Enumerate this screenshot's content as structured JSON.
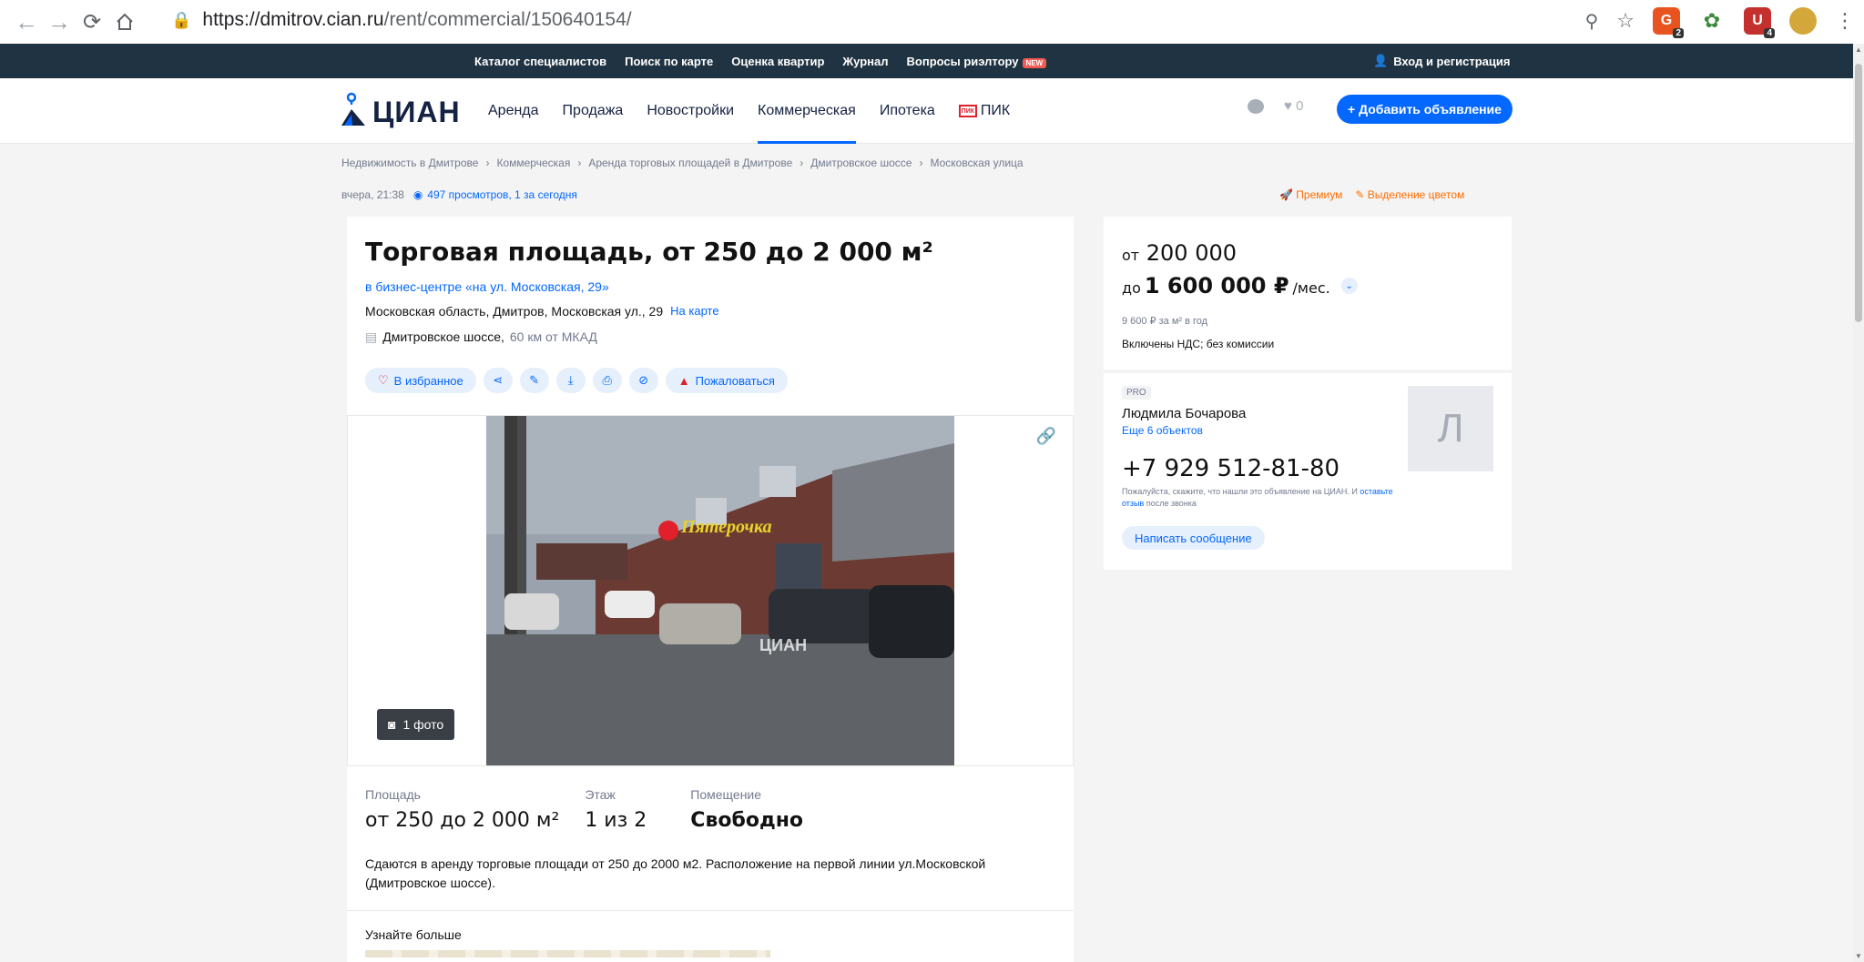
{
  "browser": {
    "url_host": "https://dmitrov.cian.ru",
    "url_path": "/rent/commercial/150640154/",
    "extension_badges": [
      "2",
      "4"
    ]
  },
  "topbar": {
    "links": [
      "Каталог специалистов",
      "Поиск по карте",
      "Оценка квартир",
      "Журнал",
      "Вопросы риэлтору"
    ],
    "new_badge": "NEW",
    "login": "Вход и регистрация"
  },
  "header": {
    "logo": "ЦИАН",
    "nav": [
      "Аренда",
      "Продажа",
      "Новостройки",
      "Коммерческая",
      "Ипотека"
    ],
    "pik": "ПИК",
    "pik_mark": "ПИК",
    "fav_count": "0",
    "add_button": "+ Добавить объявление"
  },
  "breadcrumb": [
    "Недвижимость в Дмитрове",
    "Коммерческая",
    "Аренда торговых площадей в Дмитрове",
    "Дмитровское шоссе",
    "Московская улица"
  ],
  "meta": {
    "date": "вчера, 21:38",
    "views": "497 просмотров, 1 за сегодня"
  },
  "promo": {
    "premium": "Премиум",
    "highlight": "Выделение цветом"
  },
  "listing": {
    "title": "Торговая площадь, от 250 до 2 000 м²",
    "business_center": "в бизнес-центре «на ул. Московская, 29»",
    "address": "Московская область, Дмитров, Московская ул., 29",
    "on_map": "На карте",
    "highway": "Дмитровское шоссе,",
    "distance": "60 км от МКАД",
    "favorite": "В избранное",
    "complain": "Пожаловаться",
    "photo_count": "1 фото",
    "photo_watermark": "ЦИАН",
    "store_sign": "Пятерочка",
    "features": [
      {
        "label": "Площадь",
        "value": "от 250 до 2 000 м²"
      },
      {
        "label": "Этаж",
        "value": "1 из 2"
      },
      {
        "label": "Помещение",
        "value": "Свободно"
      }
    ],
    "description": "Сдаются в аренду торговые площади от 250 до 2000 м2. Расположение на первой линии ул.Московской (Дмитровское шоссе).",
    "more_title": "Узнайте больше"
  },
  "price": {
    "from_prefix": "от",
    "from": "200 000",
    "to_prefix": "до",
    "to": "1 600 000 ₽",
    "unit": "/мес.",
    "per_m": "9 600 ₽ за м² в год",
    "vat": "Включены НДС; без комиссии"
  },
  "agent": {
    "pro": "PRO",
    "name": "Людмила Бочарова",
    "more": "Еще 6 объектов",
    "initial": "Л",
    "phone": "+7 929 512-81-80",
    "note": "Пожалуйста, скажите, что нашли это объявление на ЦИАН. И",
    "note_link": "оставьте отзыв",
    "note_tail": "после звонка",
    "message_button": "Написать сообщение"
  },
  "colors": {
    "accent": "#0468ff",
    "topbar": "#1f3342",
    "promo": "#ff6d00",
    "danger": "#e0202a"
  }
}
